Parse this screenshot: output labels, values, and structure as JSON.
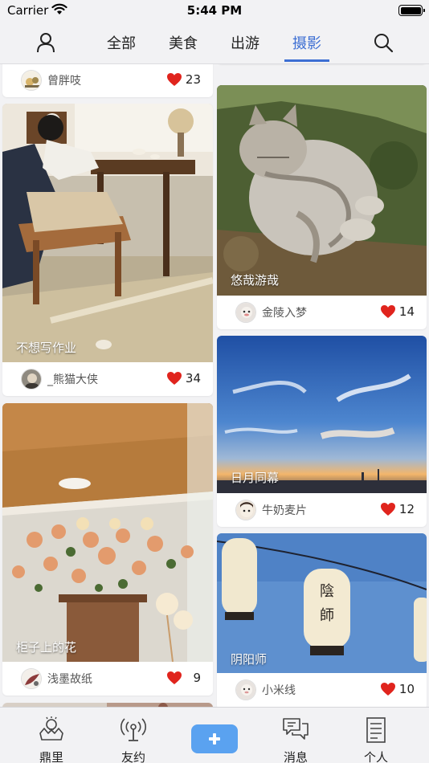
{
  "status_bar": {
    "carrier": "Carrier",
    "time": "5:44 PM"
  },
  "header": {
    "tabs": [
      {
        "label": "全部"
      },
      {
        "label": "美食"
      },
      {
        "label": "出游"
      },
      {
        "label": "摄影",
        "active": true
      }
    ],
    "accent_color": "#3d6fd3",
    "icons": [
      "person-icon",
      "search-icon"
    ]
  },
  "feed": {
    "left_column": [
      {
        "caption": "",
        "author": "曾胖吱",
        "likes": "23"
      },
      {
        "caption": "不想写作业",
        "author": "_熊猫大侠",
        "likes": "34"
      },
      {
        "caption": "柜子上的花",
        "author": "浅墨故纸",
        "likes": "9"
      }
    ],
    "right_column": [
      {
        "caption": "悠哉游哉",
        "author": "金陵入梦",
        "likes": "14"
      },
      {
        "caption": "日月同幕",
        "author": "牛奶麦片",
        "likes": "12"
      },
      {
        "caption": "阴阳师",
        "author": "小米线",
        "likes": "10"
      }
    ],
    "like_color": "#e0241d"
  },
  "tabbar": {
    "items": [
      {
        "label": "鼎里",
        "icon": "crown-icon"
      },
      {
        "label": "友约",
        "icon": "antenna-icon"
      },
      {
        "label": "",
        "icon": "plus-icon"
      },
      {
        "label": "消息",
        "icon": "chat-icon"
      },
      {
        "label": "个人",
        "icon": "document-icon"
      }
    ],
    "plus_color": "#5aa2f0"
  }
}
